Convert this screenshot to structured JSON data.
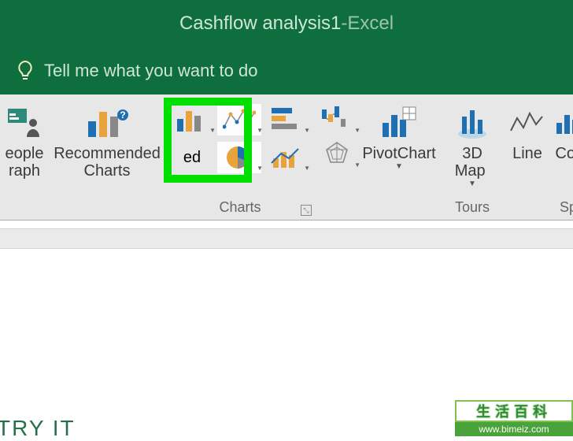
{
  "title": {
    "doc": "Cashflow analysis1",
    "sep": "  -  ",
    "app": "Excel"
  },
  "tellme": {
    "placeholder": "Tell me what you want to do"
  },
  "groups": {
    "people_graph": {
      "label": "eople\nraph"
    },
    "recommended": {
      "label": "Recommended\nCharts"
    },
    "charts": {
      "group_label": "Charts",
      "column_label": "ed",
      "items": [
        "column",
        "line",
        "pie",
        "bar",
        "hierarchy",
        "radar"
      ]
    },
    "pivot": {
      "label": "PivotChart"
    },
    "tours": {
      "group_label": "Tours",
      "label": "3D\nMap "
    },
    "sparklines": {
      "group_label": "Sparkl",
      "line": "Line",
      "column": "Colu"
    }
  },
  "corner_text": "TRY IT",
  "watermark": {
    "top": "生活百科",
    "bot": "www.bimeiz.com"
  },
  "colors": {
    "green": "#0f6e3e",
    "accent": "#1f6fb3",
    "orange": "#e8a33d",
    "teal": "#2b8a7a",
    "hl": "#00e000"
  }
}
